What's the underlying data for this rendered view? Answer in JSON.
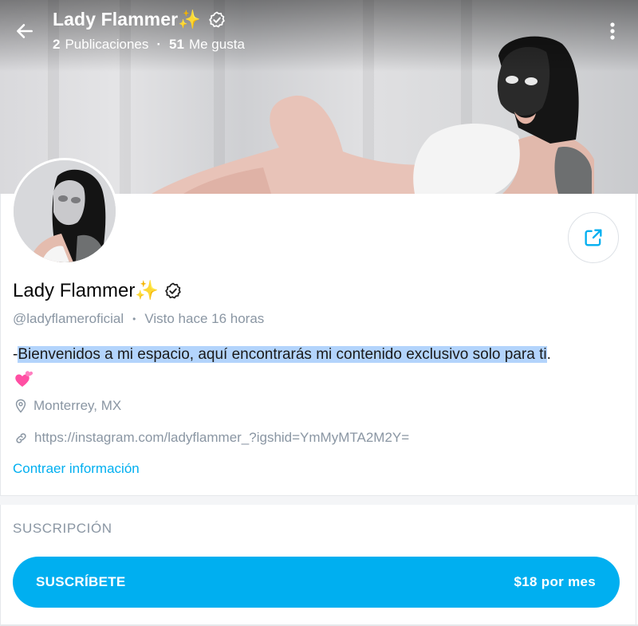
{
  "header": {
    "name": "Lady Flammer",
    "sparkle": "✨",
    "posts_count": "2",
    "posts_label": "Publicaciones",
    "likes_count": "51",
    "likes_label": "Me gusta"
  },
  "profile": {
    "name": "Lady Flammer",
    "sparkle": "✨",
    "handle": "@ladyflameroficial",
    "last_seen": "Visto hace 16 horas",
    "bio_dash": "-",
    "bio": "Bienvenidos a mi espacio, aquí encontrarás mi contenido exclusivo solo para ti",
    "bio_end": ".",
    "location": "Monterrey, MX",
    "link": "https://instagram.com/ladyflammer_?igshid=YmMyMTA2M2Y=",
    "collapse_label": "Contraer información"
  },
  "subscription": {
    "section_title": "SUSCRIPCIÓN",
    "button_label": "SUSCRÍBETE",
    "price_label": "$18 por mes"
  },
  "colors": {
    "accent": "#00aff0",
    "muted": "#8a96a3",
    "selection": "#b3d4fc"
  },
  "icons": {
    "back": "arrow-left-icon",
    "more": "more-vertical-icon",
    "verified": "verified-badge-icon",
    "share": "share-icon",
    "location": "location-pin-icon",
    "link": "link-icon",
    "heart": "two-hearts-emoji"
  }
}
